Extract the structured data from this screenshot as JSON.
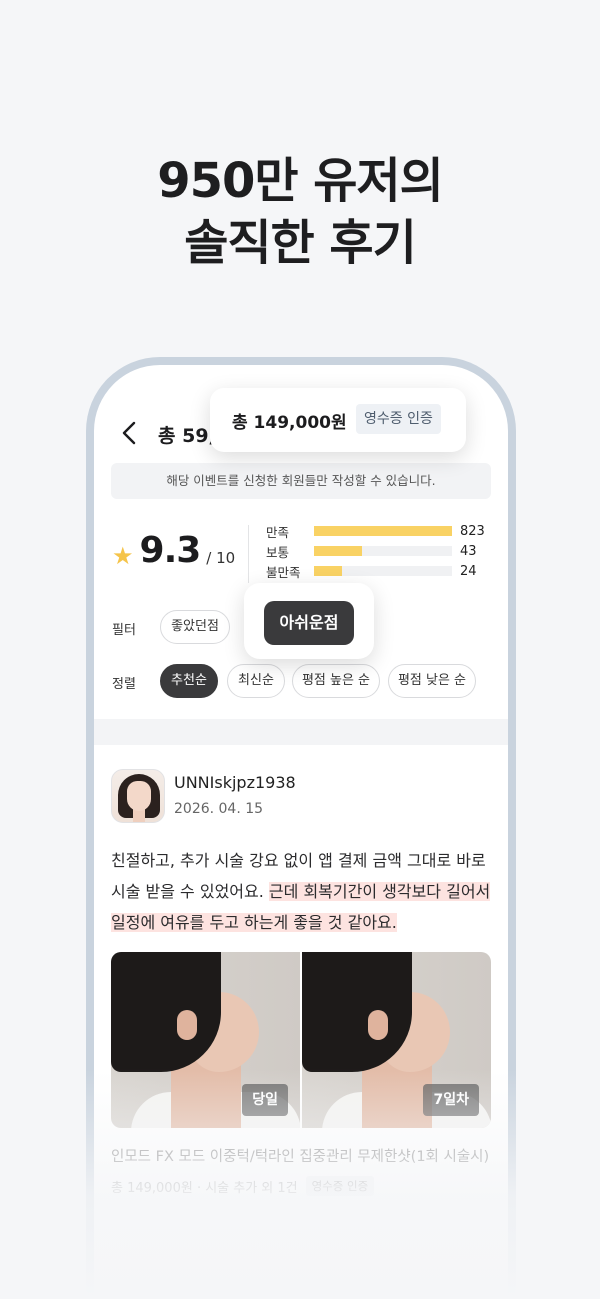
{
  "headline": {
    "line1": "950만 유저의",
    "line2": "솔직한 후기"
  },
  "header": {
    "title": "총 59,821개의 후기"
  },
  "notice": "해당 이벤트를 신청한 회원들만 작성할 수 있습니다.",
  "score": {
    "value": "9.3",
    "max": "/ 10"
  },
  "ratings": [
    {
      "label": "만족",
      "count": "823",
      "fraction": 1.0
    },
    {
      "label": "보통",
      "count": "43",
      "fraction": 0.35
    },
    {
      "label": "불만족",
      "count": "24",
      "fraction": 0.2
    }
  ],
  "filter": {
    "label": "필터",
    "options": [
      "좋았던점",
      "아쉬운점"
    ],
    "selected": "아쉬운점"
  },
  "sort": {
    "label": "정렬",
    "options": [
      "추천순",
      "최신순",
      "평점 높은 순",
      "평점 낮은 순"
    ],
    "selected": "추천순"
  },
  "review": {
    "username": "UNNIskjpz1938",
    "date": "2026. 04. 15",
    "body_plain": "친절하고, 추가 시술 강요 없이 앱 결제 금액 그대로 바로 시술 받을 수 있었어요. ",
    "body_highlight": "근데 회복기간이 생각보다 길어서 일정에 여유를 두고 하는게 좋을 것 같아요.",
    "photo_tags": [
      "당일",
      "7일차"
    ],
    "product": "인모드 FX 모드 이중턱/턱라인 집중관리 무제한샷(1회 시술시)",
    "meta_text": "총 149,000원 · 시술 추가 외 1건",
    "meta_badge": "영수증 인증"
  },
  "price_popover": {
    "price": "총 149,000원",
    "badge": "영수증 인증"
  },
  "colors": {
    "star": "#f5c44a",
    "bar": "#f9d264",
    "highlight": "#fde3e0",
    "dark_chip": "#3a3a3c",
    "frame": "#c9d3de"
  }
}
